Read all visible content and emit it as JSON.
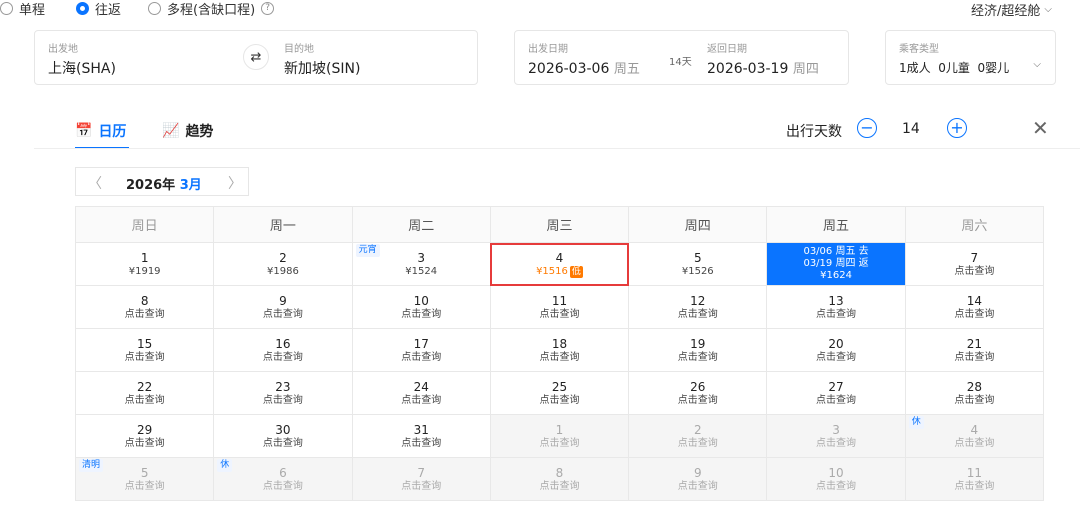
{
  "trip": {
    "one_way": "单程",
    "round_trip": "往返",
    "multi": "多程(含缺口程)",
    "help": "?",
    "cabin": "经济/超经舱"
  },
  "search": {
    "from_label": "出发地",
    "from_value": "上海(SHA)",
    "to_label": "目的地",
    "to_value": "新加坡(SIN)",
    "depart_label": "出发日期",
    "depart_date": "2026-03-06",
    "depart_week": "周五",
    "trip_days": "14天",
    "return_label": "返回日期",
    "return_date": "2026-03-19",
    "return_week": "周四",
    "pax_label": "乘客类型",
    "pax_value": "1成人  0儿童  0婴儿"
  },
  "tabs": {
    "calendar": "日历",
    "trend": "趋势"
  },
  "days": {
    "label": "出行天数",
    "minus": "−",
    "value": "14",
    "plus": "+"
  },
  "month": {
    "year": "2026年",
    "mon": "3月"
  },
  "weekdays": [
    "周日",
    "周一",
    "周二",
    "周三",
    "周四",
    "周五",
    "周六"
  ],
  "query": "点击查询",
  "low_tag": "低",
  "calendar": [
    [
      {
        "d": "1",
        "p": "¥1919"
      },
      {
        "d": "2",
        "p": "¥1986"
      },
      {
        "d": "3",
        "p": "¥1524",
        "hol": "元宵"
      },
      {
        "d": "4",
        "p": "¥1516",
        "low": true,
        "highlight": true
      },
      {
        "d": "5",
        "p": "¥1526"
      },
      {
        "selected": true,
        "lines": [
          "03/06 周五 去",
          "03/19 周四 返",
          "¥1624"
        ]
      },
      {
        "d": "7",
        "p": "点击查询"
      }
    ],
    [
      {
        "d": "8",
        "p": "点击查询"
      },
      {
        "d": "9",
        "p": "点击查询"
      },
      {
        "d": "10",
        "p": "点击查询"
      },
      {
        "d": "11",
        "p": "点击查询"
      },
      {
        "d": "12",
        "p": "点击查询"
      },
      {
        "d": "13",
        "p": "点击查询"
      },
      {
        "d": "14",
        "p": "点击查询"
      }
    ],
    [
      {
        "d": "15",
        "p": "点击查询"
      },
      {
        "d": "16",
        "p": "点击查询"
      },
      {
        "d": "17",
        "p": "点击查询"
      },
      {
        "d": "18",
        "p": "点击查询"
      },
      {
        "d": "19",
        "p": "点击查询"
      },
      {
        "d": "20",
        "p": "点击查询"
      },
      {
        "d": "21",
        "p": "点击查询"
      }
    ],
    [
      {
        "d": "22",
        "p": "点击查询"
      },
      {
        "d": "23",
        "p": "点击查询"
      },
      {
        "d": "24",
        "p": "点击查询"
      },
      {
        "d": "25",
        "p": "点击查询"
      },
      {
        "d": "26",
        "p": "点击查询"
      },
      {
        "d": "27",
        "p": "点击查询"
      },
      {
        "d": "28",
        "p": "点击查询"
      }
    ],
    [
      {
        "d": "29",
        "p": "点击查询"
      },
      {
        "d": "30",
        "p": "点击查询"
      },
      {
        "d": "31",
        "p": "点击查询"
      },
      {
        "d": "1",
        "p": "点击查询",
        "gray": true
      },
      {
        "d": "2",
        "p": "点击查询",
        "gray": true
      },
      {
        "d": "3",
        "p": "点击查询",
        "gray": true
      },
      {
        "d": "4",
        "p": "点击查询",
        "gray": true,
        "hol": "休"
      }
    ],
    [
      {
        "d": "5",
        "p": "点击查询",
        "gray": true,
        "hol": "清明"
      },
      {
        "d": "6",
        "p": "点击查询",
        "gray": true,
        "hol": "休"
      },
      {
        "d": "7",
        "p": "点击查询",
        "gray": true
      },
      {
        "d": "8",
        "p": "点击查询",
        "gray": true
      },
      {
        "d": "9",
        "p": "点击查询",
        "gray": true
      },
      {
        "d": "10",
        "p": "点击查询",
        "gray": true
      },
      {
        "d": "11",
        "p": "点击查询",
        "gray": true
      }
    ]
  ]
}
